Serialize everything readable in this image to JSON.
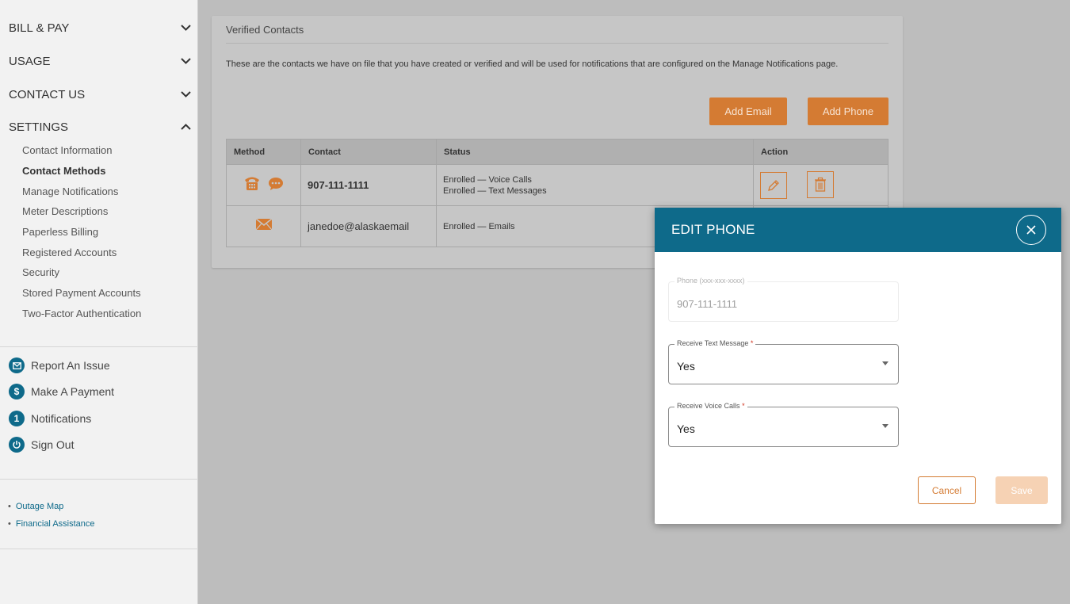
{
  "sidebar": {
    "sections": [
      {
        "label": "BILL & PAY",
        "expanded": false
      },
      {
        "label": "USAGE",
        "expanded": false
      },
      {
        "label": "CONTACT US",
        "expanded": false
      },
      {
        "label": "SETTINGS",
        "expanded": true
      }
    ],
    "settings_items": [
      {
        "label": "Contact Information",
        "active": false
      },
      {
        "label": "Contact Methods",
        "active": true
      },
      {
        "label": "Manage Notifications",
        "active": false
      },
      {
        "label": "Meter Descriptions",
        "active": false
      },
      {
        "label": "Paperless Billing",
        "active": false
      },
      {
        "label": "Registered Accounts",
        "active": false
      },
      {
        "label": "Security",
        "active": false
      },
      {
        "label": "Stored Payment Accounts",
        "active": false
      },
      {
        "label": "Two-Factor Authentication",
        "active": false
      }
    ],
    "actions": [
      {
        "label": "Report An Issue",
        "icon": "envelope-icon"
      },
      {
        "label": "Make A Payment",
        "icon": "dollar-icon"
      },
      {
        "label": "Notifications",
        "icon": "notification-count-icon",
        "badge": "1"
      },
      {
        "label": "Sign Out",
        "icon": "power-icon"
      }
    ],
    "footer_links": [
      "Outage Map",
      "Financial Assistance"
    ]
  },
  "card": {
    "title": "Verified Contacts",
    "description": "These are the contacts we have on file that you have created or verified and will be used for notifications that are configured on the Manage Notifications page.",
    "add_email_label": "Add Email",
    "add_phone_label": "Add Phone",
    "table": {
      "headers": [
        "Method",
        "Contact",
        "Status",
        "Action"
      ],
      "rows": [
        {
          "methods": [
            "phone-icon",
            "chat-icon"
          ],
          "contact": "907-111-1111",
          "status": [
            "Enrolled — Voice Calls",
            "Enrolled — Text Messages"
          ]
        },
        {
          "methods": [
            "envelope-icon"
          ],
          "contact": "janedoe@alaskaemail",
          "status": [
            "Enrolled — Emails"
          ]
        }
      ]
    }
  },
  "modal": {
    "title": "EDIT PHONE",
    "phone_label": "Phone (xxx-xxx-xxxx)",
    "phone_value": "907-111-1111",
    "text_label": "Receive Text Message",
    "text_value": "Yes",
    "voice_label": "Receive Voice Calls",
    "voice_value": "Yes",
    "required_mark": "*",
    "cancel_label": "Cancel",
    "save_label": "Save"
  },
  "colors": {
    "accent_orange": "#d47b33",
    "brand_teal": "#0e6a8a"
  }
}
